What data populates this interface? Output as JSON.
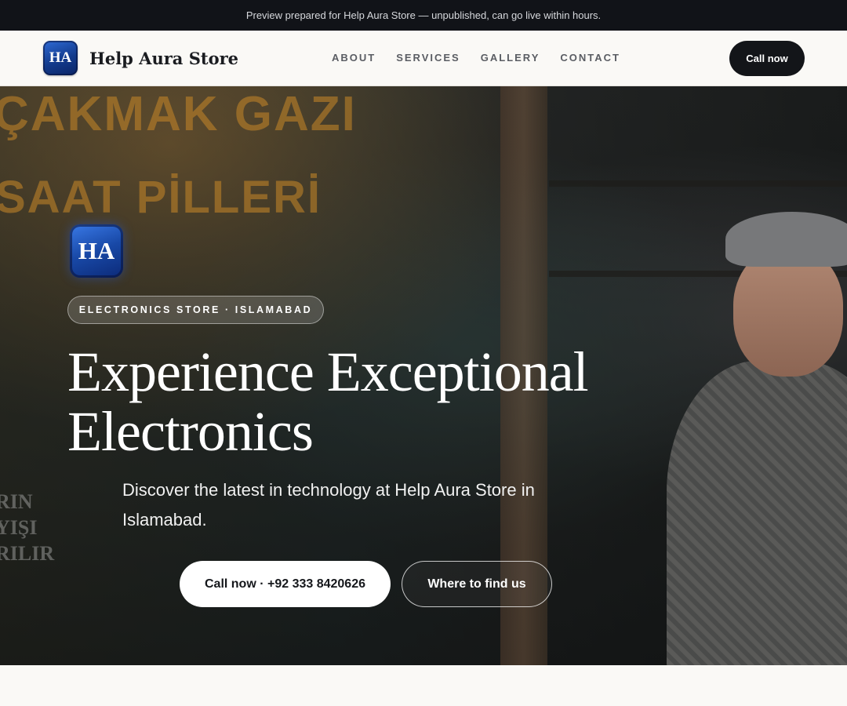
{
  "preview_bar": {
    "text": "Preview prepared for Help Aura Store — unpublished, can go live within hours."
  },
  "nav": {
    "logo_initials": "HA",
    "brand_name": "Help Aura Store",
    "links": [
      {
        "label": "ABOUT"
      },
      {
        "label": "SERVICES"
      },
      {
        "label": "GALLERY"
      },
      {
        "label": "CONTACT"
      }
    ],
    "cta_label": "Call now"
  },
  "hero": {
    "logo_initials": "HA",
    "eyebrow": "ELECTRONICS STORE · ISLAMABAD",
    "headline": "Experience Exceptional Electronics",
    "subline": "Discover the latest in technology at Help Aura Store in Islamabad.",
    "primary_button": "Call now · +92 333 8420626",
    "secondary_button": "Where to find us",
    "photo_sign_top": "ÇAKMAK GAZI",
    "photo_sign_mid": "SAAT PİLLERİ",
    "photo_sign_left": [
      "RIN",
      "YIŞI",
      "RILIR"
    ]
  },
  "colors": {
    "top_bar": "#111318",
    "nav_bg": "#faf9f6",
    "logo_blue": "#1848a6",
    "dark_button": "#131519"
  }
}
